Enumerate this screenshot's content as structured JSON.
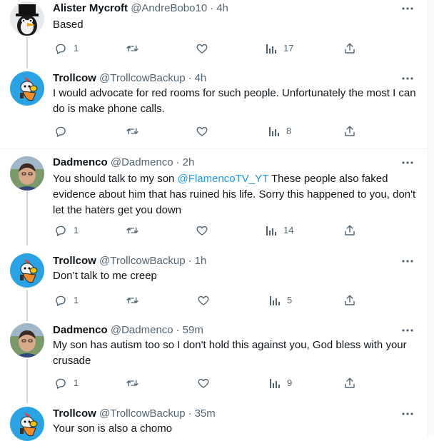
{
  "colors": {
    "accent": "#1d9bf0",
    "secondary_text": "#536471",
    "divider": "#eff3f4",
    "thread_line": "#cfd9de"
  },
  "tweets": [
    {
      "name": "Alister Mycroft",
      "handle": "@AndreBobo10",
      "sep": "·",
      "time": "4h",
      "text": "Based",
      "replies": "1",
      "retweets": "",
      "likes": "",
      "views": "17"
    },
    {
      "name": "Trollcow",
      "handle": "@TrollcowBackup",
      "sep": "·",
      "time": "4h",
      "text": "I would advocate for red rooms for such people. Unfortunately the most I can do is make phone calls.",
      "replies": "",
      "retweets": "",
      "likes": "",
      "views": "8"
    },
    {
      "name": "Dadmenco",
      "handle": "@Dadmenco",
      "sep": "·",
      "time": "2h",
      "text_before": "You should talk to my son ",
      "mention": "@FlamencoTV_YT",
      "text_after": " These people also faked evidence about him that has ruined his life. Sorry this happened to you, don't let the haters get you down",
      "replies": "1",
      "retweets": "",
      "likes": "",
      "views": "14"
    },
    {
      "name": "Trollcow",
      "handle": "@TrollcowBackup",
      "sep": "·",
      "time": "1h",
      "text": "Don’t talk to me creep",
      "replies": "1",
      "retweets": "",
      "likes": "",
      "views": "5"
    },
    {
      "name": "Dadmenco",
      "handle": "@Dadmenco",
      "sep": "·",
      "time": "59m",
      "text": "My son has autism too so I don't hold this against you, God bless with your crusade",
      "replies": "1",
      "retweets": "",
      "likes": "",
      "views": "9"
    },
    {
      "name": "Trollcow",
      "handle": "@TrollcowBackup",
      "sep": "·",
      "time": "35m",
      "text": "Your son is also a chomo"
    }
  ],
  "icons": {
    "reply": "reply-icon",
    "retweet": "retweet-icon",
    "like": "heart-icon",
    "views": "views-icon",
    "share": "share-icon",
    "more": "more-icon"
  }
}
